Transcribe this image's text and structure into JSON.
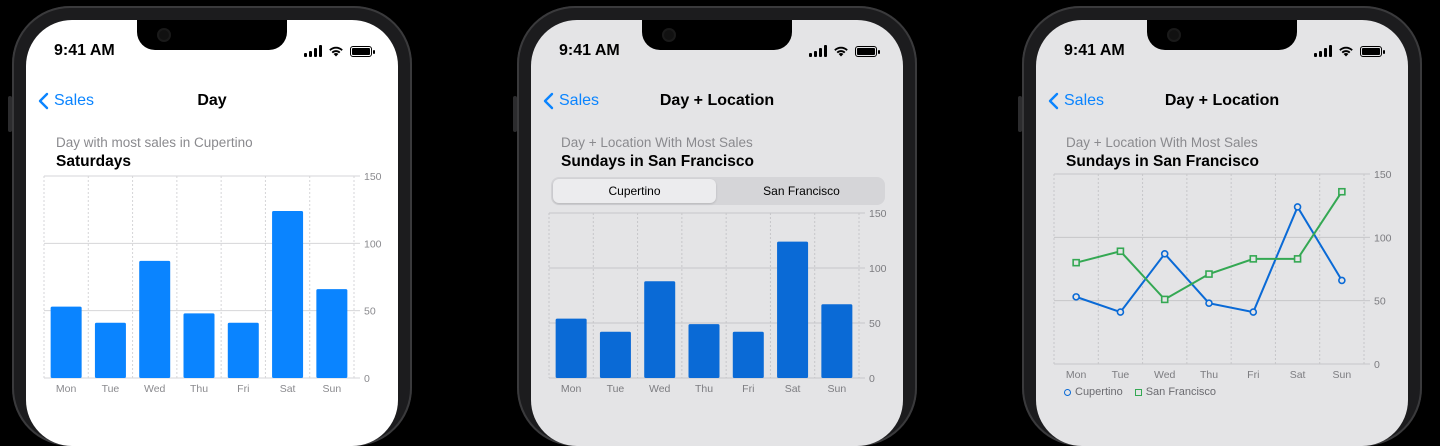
{
  "colors": {
    "accent": "#0a84ff",
    "bar_light": "#0a84ff",
    "bar_dim": "#0a6ad6",
    "cupertino_line": "#0a6ad6",
    "sf_line": "#34a853"
  },
  "phones": [
    {
      "status": {
        "time": "9:41 AM"
      },
      "nav": {
        "back_label": "Sales",
        "title": "Day"
      },
      "subtitle": "Day with most sales in Cupertino",
      "headline": "Saturdays",
      "chart_data": {
        "type": "bar",
        "categories": [
          "Mon",
          "Tue",
          "Wed",
          "Thu",
          "Fri",
          "Sat",
          "Sun"
        ],
        "values": [
          53,
          41,
          87,
          48,
          41,
          124,
          66
        ],
        "y_ticks": [
          0,
          50,
          100,
          150
        ],
        "ylim": [
          0,
          150
        ],
        "grid": true
      }
    },
    {
      "status": {
        "time": "9:41 AM"
      },
      "nav": {
        "back_label": "Sales",
        "title": "Day + Location"
      },
      "subtitle": "Day + Location With Most Sales",
      "headline": "Sundays in San Francisco",
      "segmented": {
        "options": [
          "Cupertino",
          "San Francisco"
        ],
        "selected": "Cupertino"
      },
      "chart_data": {
        "type": "bar",
        "categories": [
          "Mon",
          "Tue",
          "Wed",
          "Thu",
          "Fri",
          "Sat",
          "Sun"
        ],
        "values": [
          54,
          42,
          88,
          49,
          42,
          124,
          67
        ],
        "y_ticks": [
          0,
          50,
          100,
          150
        ],
        "ylim": [
          0,
          150
        ],
        "grid": true
      }
    },
    {
      "status": {
        "time": "9:41 AM"
      },
      "nav": {
        "back_label": "Sales",
        "title": "Day + Location"
      },
      "subtitle": "Day + Location With Most Sales",
      "headline": "Sundays in San Francisco",
      "chart_data": {
        "type": "line",
        "categories": [
          "Mon",
          "Tue",
          "Wed",
          "Thu",
          "Fri",
          "Sat",
          "Sun"
        ],
        "series": [
          {
            "name": "Cupertino",
            "values": [
              53,
              41,
              87,
              48,
              41,
              124,
              66
            ]
          },
          {
            "name": "San Francisco",
            "values": [
              80,
              89,
              51,
              71,
              83,
              83,
              136
            ]
          }
        ],
        "y_ticks": [
          0,
          50,
          100,
          150
        ],
        "ylim": [
          0,
          150
        ],
        "grid": true,
        "legend": "bottom-left"
      }
    }
  ]
}
